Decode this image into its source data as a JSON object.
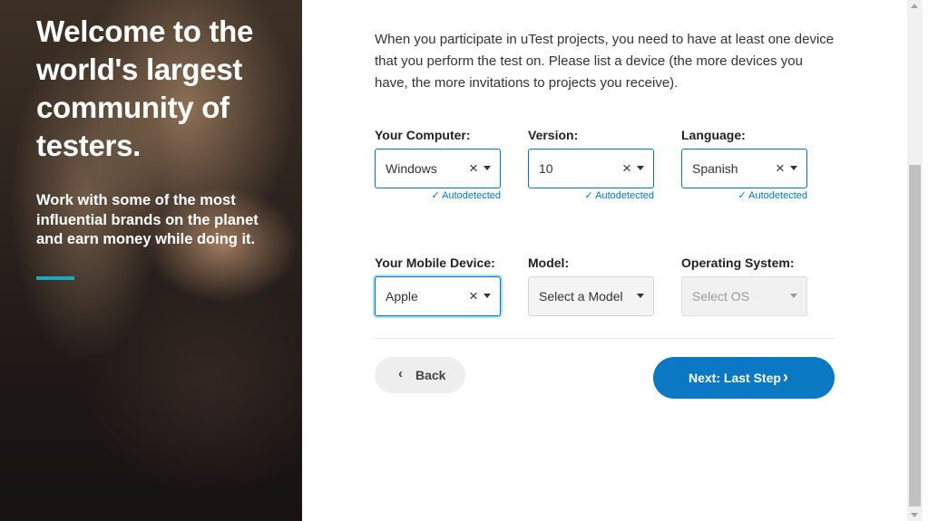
{
  "hero": {
    "title": "Welcome to the world's largest community of testers.",
    "subtitle": "Work with some of the most influential brands on the planet and earn money while doing it.",
    "accent_color": "#1aa6c9"
  },
  "intro_text": "When you participate in uTest projects, you need to have at least one device that you perform the test on. Please list a device (the more devices you have, the more invitations to projects you receive).",
  "computer_row": {
    "computer": {
      "label": "Your Computer:",
      "value": "Windows",
      "note": "Autodetected",
      "clear_icon": "close-icon"
    },
    "version": {
      "label": "Version:",
      "value": "10",
      "note": "Autodetected",
      "clear_icon": "close-icon"
    },
    "language": {
      "label": "Language:",
      "value": "Spanish",
      "note": "Autodetected",
      "clear_icon": "close-icon"
    }
  },
  "mobile_row": {
    "device": {
      "label": "Your Mobile Device:",
      "value": "Apple",
      "clear_icon": "close-icon"
    },
    "model": {
      "label": "Model:",
      "placeholder": "Select a Model"
    },
    "os": {
      "label": "Operating System:",
      "placeholder": "Select OS",
      "disabled": true
    }
  },
  "buttons": {
    "back_label": "Back",
    "next_label": "Next: Last Step",
    "primary_color": "#0a78c3"
  },
  "icons": {
    "check": "✓",
    "clear": "×",
    "back_chevron": "‹",
    "next_chevron": "›"
  },
  "colors": {
    "focus_border": "#0077c8",
    "focus_glow": "#a9e0f2",
    "autodetect_text": "#0077c8"
  }
}
